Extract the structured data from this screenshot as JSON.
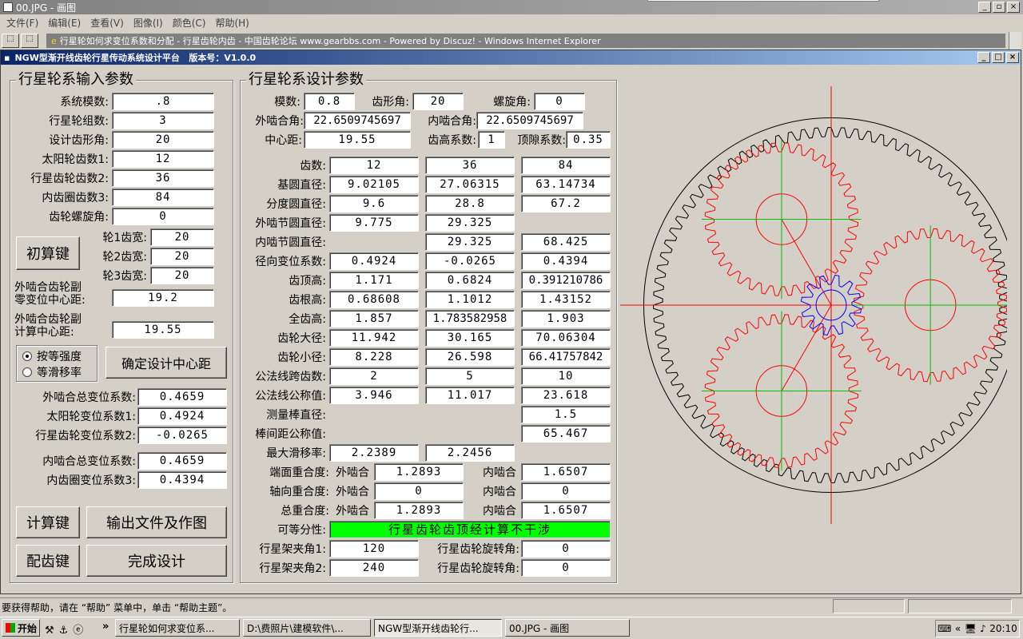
{
  "outer_window": {
    "title": "00.JPG - 画图",
    "menu": [
      "文件(F)",
      "编辑(E)",
      "查看(V)",
      "图像(I)",
      "颜色(C)",
      "帮助(H)"
    ],
    "status": "要获得帮助，请在 “帮助” 菜单中，单击 “帮助主题”。"
  },
  "ie_title": "行星轮如何求变位系数和分配 - 行星齿轮内齿 - 中国齿轮论坛 www.gearbbs.com - Powered by Discuz! - Windows Internet Explorer",
  "app": {
    "title": "NGW型渐开线齿轮行星传动系统设计平台   版本号：V1.0.0"
  },
  "input_group": {
    "title": "行星轮系输入参数",
    "rows": [
      {
        "label": "系统模数:",
        "value": ".8"
      },
      {
        "label": "行星轮组数:",
        "value": "3"
      },
      {
        "label": "设计齿形角:",
        "value": "20"
      },
      {
        "label": "太阳轮齿数1:",
        "value": "12"
      },
      {
        "label": "行星齿轮齿数2:",
        "value": "36"
      },
      {
        "label": "内齿圈齿数3:",
        "value": "84"
      },
      {
        "label": "齿轮螺旋角:",
        "value": "0"
      }
    ],
    "calc_button": "初算键",
    "widths": [
      {
        "label": "轮1齿宽:",
        "value": "20"
      },
      {
        "label": "轮2齿宽:",
        "value": "20"
      },
      {
        "label": "轮3齿宽:",
        "value": "20"
      }
    ],
    "ext_zero_label": "外啮合齿轮副\n零变位中心距:",
    "ext_zero_value": "19.2",
    "ext_calc_label": "外啮合齿轮副\n计算中心距:",
    "ext_calc_value": "19.55",
    "radio1": "按等强度",
    "radio2": "等滑移率",
    "confirm_button": "确定设计中心距",
    "coef": [
      {
        "label": "外啮合总变位系数:",
        "value": "0.4659"
      },
      {
        "label": "太阳轮变位系数1:",
        "value": "0.4924"
      },
      {
        "label": "行星齿轮变位系数2:",
        "value": "-0.0265"
      },
      {
        "label": "内啮合总变位系数:",
        "value": "0.4659"
      },
      {
        "label": "内齿圈变位系数3:",
        "value": "0.4394"
      }
    ],
    "btn_compute": "计算键",
    "btn_output": "输出文件及作图",
    "btn_match": "配齿键",
    "btn_finish": "完成设计"
  },
  "design_group": {
    "title": "行星轮系设计参数",
    "modulus_label": "模数:",
    "modulus": "0.8",
    "tooth_angle_label": "齿形角:",
    "tooth_angle": "20",
    "helix_label": "螺旋角:",
    "helix": "0",
    "ext_mesh_label": "外啮合角:",
    "ext_mesh": "22.6509745697",
    "int_mesh_label": "内啮合角:",
    "int_mesh": "22.6509745697",
    "center_label": "中心距:",
    "center": "19.55",
    "addendum_label": "齿高系数:",
    "addendum": "1",
    "clearance_label": "顶隙系数:",
    "clearance": "0.35",
    "table": [
      {
        "label": "齿数:",
        "v": [
          "12",
          "36",
          "84"
        ]
      },
      {
        "label": "基圆直径:",
        "v": [
          "9.02105",
          "27.06315",
          "63.14734"
        ]
      },
      {
        "label": "分度圆直径:",
        "v": [
          "9.6",
          "28.8",
          "67.2"
        ]
      },
      {
        "label": "外啮节圆直径:",
        "v": [
          "9.775",
          "29.325",
          ""
        ]
      },
      {
        "label": "内啮节圆直径:",
        "v": [
          "",
          "29.325",
          "68.425"
        ]
      },
      {
        "label": "径向变位系数:",
        "v": [
          "0.4924",
          "-0.0265",
          "0.4394"
        ]
      },
      {
        "label": "齿顶高:",
        "v": [
          "1.171",
          "0.6824",
          "0.391210786"
        ]
      },
      {
        "label": "齿根高:",
        "v": [
          "0.68608",
          "1.1012",
          "1.43152"
        ]
      },
      {
        "label": "全齿高:",
        "v": [
          "1.857",
          "1.783582958",
          "1.903"
        ]
      },
      {
        "label": "齿轮大径:",
        "v": [
          "11.942",
          "30.165",
          "70.06304"
        ]
      },
      {
        "label": "齿轮小径:",
        "v": [
          "8.228",
          "26.598",
          "66.41757842"
        ]
      },
      {
        "label": "公法线跨齿数:",
        "v": [
          "2",
          "5",
          "10"
        ]
      },
      {
        "label": "公法线公称值:",
        "v": [
          "3.946",
          "11.017",
          "23.618"
        ]
      },
      {
        "label": "测量棒直径:",
        "v": [
          "",
          "",
          "1.5"
        ]
      },
      {
        "label": "棒间距公称值:",
        "v": [
          "",
          "",
          "65.467"
        ]
      },
      {
        "label": "最大滑移率:",
        "v": [
          "2.2389",
          "2.2456",
          ""
        ]
      }
    ],
    "overlap": [
      {
        "label": "端面重合度:",
        "ext_label": "外啮合",
        "ext": "1.2893",
        "int_label": "内啮合",
        "int": "1.6507"
      },
      {
        "label": "轴向重合度:",
        "ext_label": "外啮合",
        "ext": "0",
        "int_label": "内啮合",
        "int": "0"
      },
      {
        "label": "总重合度:",
        "ext_label": "外啮合",
        "ext": "1.2893",
        "int_label": "内啮合",
        "int": "1.6507"
      }
    ],
    "assembly_label": "可等分性:",
    "assembly": "行星齿轮齿顶经计算不干涉",
    "carrier": [
      {
        "label": "行星架夹角1:",
        "value": "120",
        "rot_label": "行星齿轮旋转角:",
        "rot": "0"
      },
      {
        "label": "行星架夹角2:",
        "value": "240",
        "rot_label": "行星齿轮旋转角:",
        "rot": "0"
      }
    ]
  },
  "taskbar": {
    "start": "开始",
    "items": [
      "行星轮如何求变位系...",
      "D:\\费照片\\建模软件\\...",
      "NGW型渐开线齿轮行...",
      "00.JPG - 画图"
    ],
    "clock": "20:10"
  },
  "colors": {
    "ring": "#000000",
    "planet": "#ff0000",
    "sun": "#0000ff",
    "axis": "#00c000",
    "center": "#ff0000",
    "title": "#0a246a",
    "ok": "#00ff00"
  }
}
